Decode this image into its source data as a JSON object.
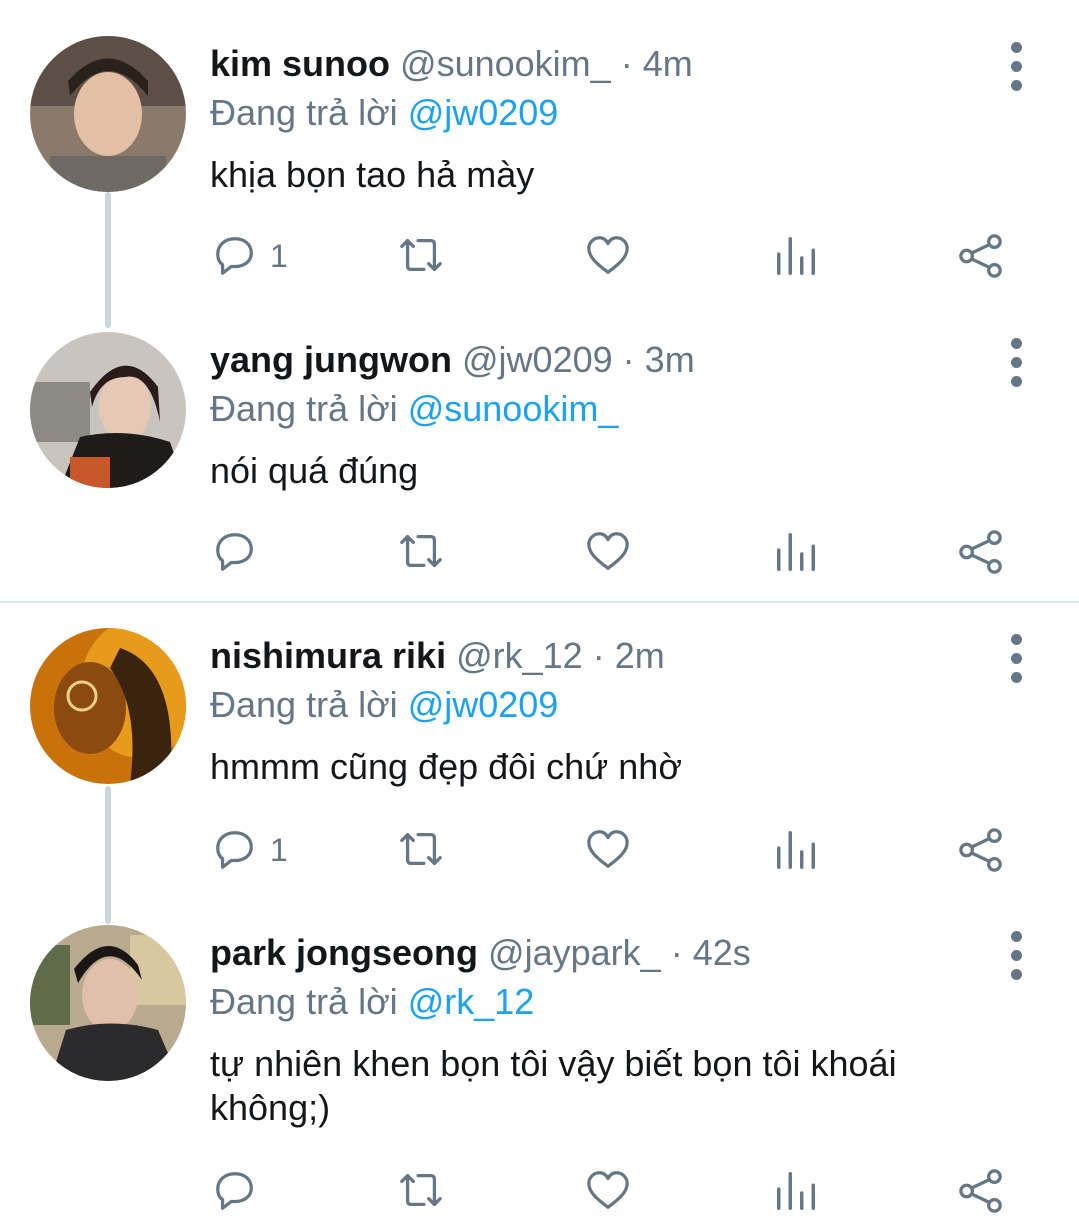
{
  "colors": {
    "link": "#1da1f2",
    "muted": "#657786",
    "text": "#14171a",
    "thread": "#ccd6dd"
  },
  "tweets": [
    {
      "name": "kim sunoo",
      "handle": "@sunookim_",
      "sep": "·",
      "time": "4m",
      "reply_prefix": "Đang trả lời",
      "reply_to": "@jw0209",
      "text": "khịa bọn tao hả mày",
      "reply_count": "1"
    },
    {
      "name": "yang jungwon",
      "handle": "@jw0209",
      "sep": "·",
      "time": "3m",
      "reply_prefix": "Đang trả lời",
      "reply_to": "@sunookim_",
      "text": "nói quá đúng",
      "reply_count": ""
    },
    {
      "name": "nishimura riki",
      "handle": "@rk_12",
      "sep": "·",
      "time": "2m",
      "reply_prefix": "Đang trả lời",
      "reply_to": "@jw0209",
      "text": "hmmm cũng đẹp đôi chứ nhờ",
      "reply_count": "1"
    },
    {
      "name": "park jongseong",
      "handle": "@jaypark_",
      "sep": "·",
      "time": "42s",
      "reply_prefix": "Đang trả lời",
      "reply_to": "@rk_12",
      "text": "tự nhiên khen bọn tôi vậy biết bọn tôi khoái không;)",
      "reply_count": ""
    }
  ],
  "icons": [
    "reply-icon",
    "retweet-icon",
    "like-icon",
    "analytics-icon",
    "share-icon",
    "more-options-icon"
  ]
}
